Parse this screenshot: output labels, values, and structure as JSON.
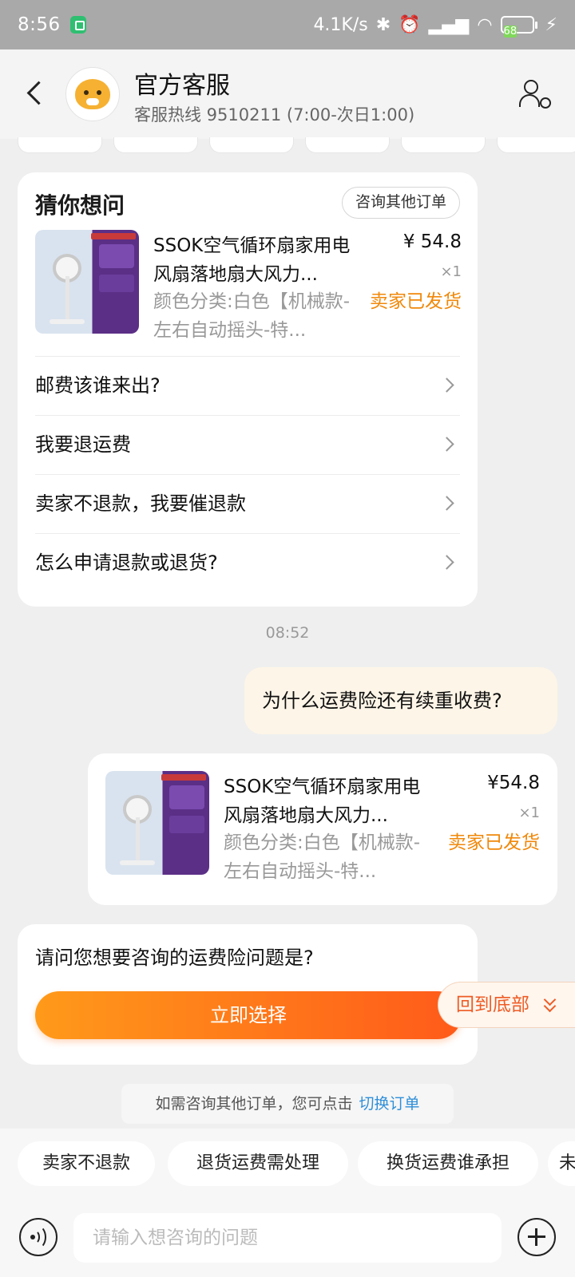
{
  "status_bar": {
    "time": "8:56",
    "net_speed": "4.1K/s",
    "battery": "68",
    "icons": [
      "shield-icon",
      "bluetooth-icon",
      "alarm-icon",
      "signal-icon",
      "wifi-icon",
      "charging-icon"
    ]
  },
  "header": {
    "title": "官方客服",
    "subtitle": "客服热线 9510211 (7:00-次日1:00)"
  },
  "guess": {
    "title": "猜你想问",
    "other_order_button": "咨询其他订单",
    "product": {
      "name": "SSOK空气循环扇家用电风扇落地扇大风力...",
      "spec": "颜色分类:白色【机械款-左右自动摇头-特...",
      "price": "¥ 54.8",
      "qty": "×1",
      "status": "卖家已发货"
    },
    "faqs": [
      "邮费该谁来出?",
      "我要退运费",
      "卖家不退款，我要催退款",
      "怎么申请退款或退货?"
    ]
  },
  "chat": {
    "timestamp": "08:52",
    "user_message": "为什么运费险还有续重收费?",
    "order": {
      "name": "SSOK空气循环扇家用电风扇落地扇大风力...",
      "spec": "颜色分类:白色【机械款-左右自动摇头-特...",
      "price": "¥54.8",
      "qty": "×1",
      "status": "卖家已发货"
    },
    "ask_text": "请问您想要咨询的运费险问题是?",
    "select_button": "立即选择",
    "to_bottom": "回到底部",
    "switch_tip": "如需咨询其他订单，您可点击",
    "switch_link": "切换订单"
  },
  "quick_chips": [
    "卖家不退款",
    "退货运费需处理",
    "换货运费谁承担",
    "未"
  ],
  "input": {
    "placeholder": "请输入想咨询的问题"
  },
  "colors": {
    "accent_orange": "#ff6a1a",
    "status_orange": "#f0880a",
    "link_blue": "#2f8fd8"
  }
}
